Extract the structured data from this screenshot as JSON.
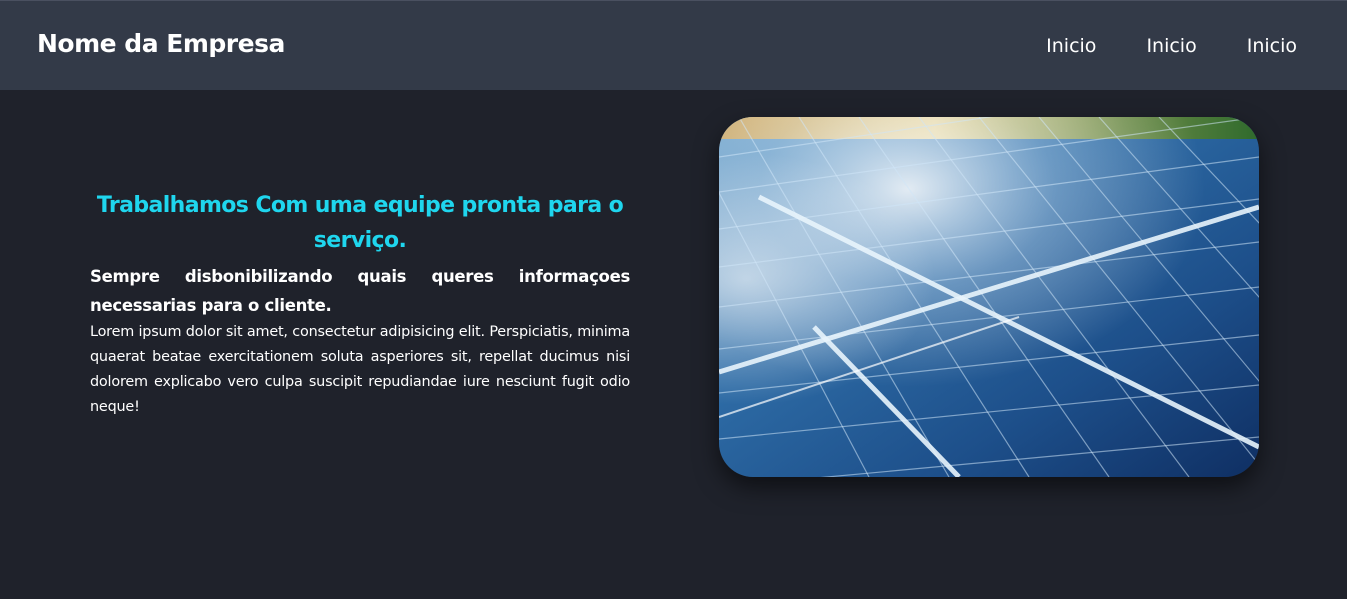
{
  "header": {
    "brand": "Nome da Empresa",
    "nav": [
      "Inicio",
      "Inicio",
      "Inicio"
    ]
  },
  "main": {
    "headline": "Trabalhamos Com uma equipe pronta para o serviço.",
    "subheadline": "Sempre disbonibilizando quais queres informaçoes necessarias para o cliente.",
    "body": "Lorem ipsum dolor sit amet, consectetur adipisicing elit. Perspiciatis, minima quaerat beatae exercitationem soluta asperiores sit, repellat ducimus nisi dolorem explicabo vero culpa suscipit repudiandae iure nesciunt fugit odio neque!"
  },
  "colors": {
    "page_background": "#1f222b",
    "header_background": "#333a48",
    "accent": "#1fd6ee",
    "text": "#ffffff"
  },
  "image": {
    "subject": "solar-panels-photo"
  }
}
